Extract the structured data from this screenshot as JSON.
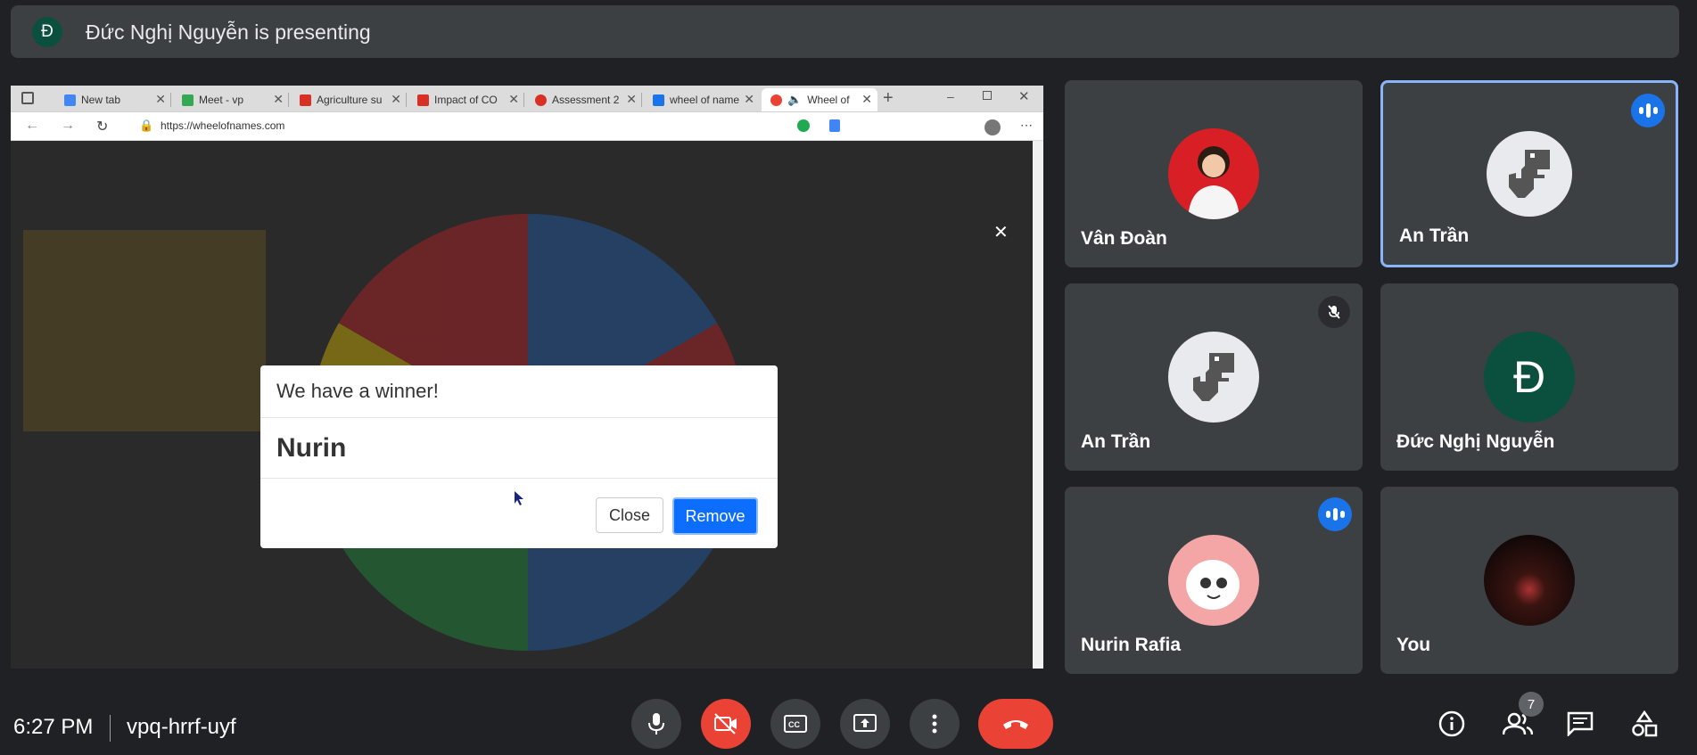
{
  "presenter": {
    "initial": "Đ",
    "text": "Đức Nghị Nguyễn is presenting"
  },
  "browser": {
    "tabs": [
      {
        "label": "New tab",
        "color": "#4285f4"
      },
      {
        "label": "Meet - vp",
        "color": "#34a853"
      },
      {
        "label": "Agriculture su",
        "color": "#d93025"
      },
      {
        "label": "Impact of CO",
        "color": "#d93025"
      },
      {
        "label": "Assessment 2",
        "color": "#d93025"
      },
      {
        "label": "wheel of name",
        "color": "#1a73e8"
      },
      {
        "label": "Wheel of",
        "color": "#ea4335",
        "active": true
      }
    ],
    "url": "https://wheelofnames.com"
  },
  "dialog": {
    "title": "We have a winner!",
    "winner": "Nurin",
    "close_label": "Close",
    "remove_label": "Remove"
  },
  "participants": [
    {
      "name": "Vân Đoàn",
      "avatar": "photo-girl",
      "speaking": false,
      "muted": false,
      "active": false
    },
    {
      "name": "An Trần",
      "avatar": "dino",
      "speaking": true,
      "muted": false,
      "active": true
    },
    {
      "name": "An Trần",
      "avatar": "dino",
      "speaking": false,
      "muted": true,
      "active": false
    },
    {
      "name": "Đức Nghị Nguyễn",
      "avatar": "initial",
      "initial": "Đ",
      "speaking": false,
      "muted": false,
      "active": false
    },
    {
      "name": "Nurin Rafia",
      "avatar": "cartoon",
      "speaking": true,
      "muted": false,
      "active": false
    },
    {
      "name": "You",
      "avatar": "night-photo",
      "speaking": false,
      "muted": false,
      "active": false
    }
  ],
  "bottom": {
    "time": "6:27 PM",
    "meeting_code": "vpq-hrrf-uyf",
    "people_count": "7"
  },
  "colors": {
    "background": "#202124",
    "tile": "#3c4043",
    "accent": "#1a73e8",
    "danger": "#ea4335"
  }
}
